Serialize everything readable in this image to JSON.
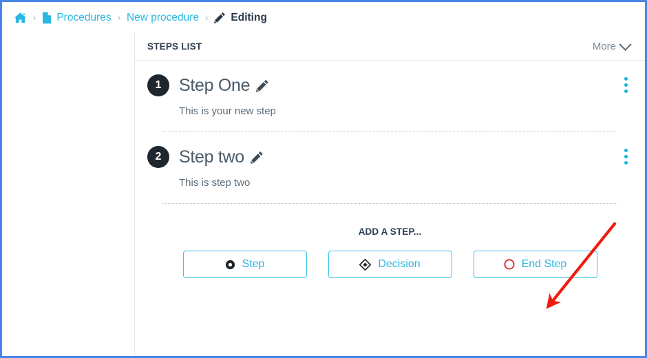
{
  "breadcrumb": {
    "home_icon": "home-icon",
    "items": [
      {
        "label": "Procedures",
        "icon": "document-icon",
        "current": false
      },
      {
        "label": "New procedure",
        "icon": "",
        "current": false
      },
      {
        "label": "Editing",
        "icon": "pencil-icon",
        "current": true
      }
    ],
    "separator": "›"
  },
  "panel": {
    "title": "STEPS LIST",
    "more_label": "More",
    "more_icon": "chevron-down-icon"
  },
  "steps": [
    {
      "number": "1",
      "title": "Step One",
      "description": "This is your new step",
      "edit_icon": "pencil-icon",
      "menu_icon": "kebab-menu-icon"
    },
    {
      "number": "2",
      "title": "Step two",
      "description": "This is step two",
      "edit_icon": "pencil-icon",
      "menu_icon": "kebab-menu-icon"
    }
  ],
  "add_step": {
    "label": "ADD A STEP...",
    "buttons": [
      {
        "label": "Step",
        "icon": "filled-circle-node-icon"
      },
      {
        "label": "Decision",
        "icon": "diamond-decision-icon"
      },
      {
        "label": "End Step",
        "icon": "red-circle-end-icon"
      }
    ]
  },
  "colors": {
    "accent_cyan": "#29b6e0",
    "page_border_blue": "#4a86e8",
    "badge_dark": "#1f262d",
    "annotation_red": "#ee1b11",
    "end_step_red": "#d4191a"
  }
}
